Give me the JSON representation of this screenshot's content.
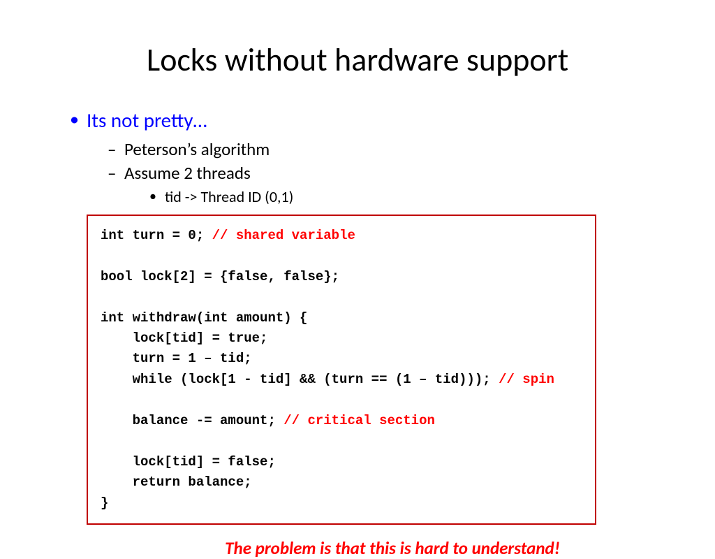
{
  "title": "Locks without hardware support",
  "bullets": {
    "lvl1_0": "Its not pretty…",
    "lvl2_0": "Peterson’s algorithm",
    "lvl2_1": "Assume 2 threads",
    "lvl3_0": "tid -> Thread ID (0,1)"
  },
  "code": {
    "l1a": "int turn = 0; ",
    "l1b": "// shared variable",
    "l2": "",
    "l3": "bool lock[2] = {false, false};",
    "l4": "",
    "l5": "int withdraw(int amount) {",
    "l6": "    lock[tid] = true;",
    "l7": "    turn = 1 – tid;",
    "l8a": "    while (lock[1 - tid] && (turn == (1 – tid))); ",
    "l8b": "// spin",
    "l9": "",
    "l10a": "    balance -= amount; ",
    "l10b": "// critical section",
    "l11": "",
    "l12": "    lock[tid] = false;",
    "l13": "    return balance;",
    "l14": "}"
  },
  "footnote": "The problem is that this is hard to understand!"
}
